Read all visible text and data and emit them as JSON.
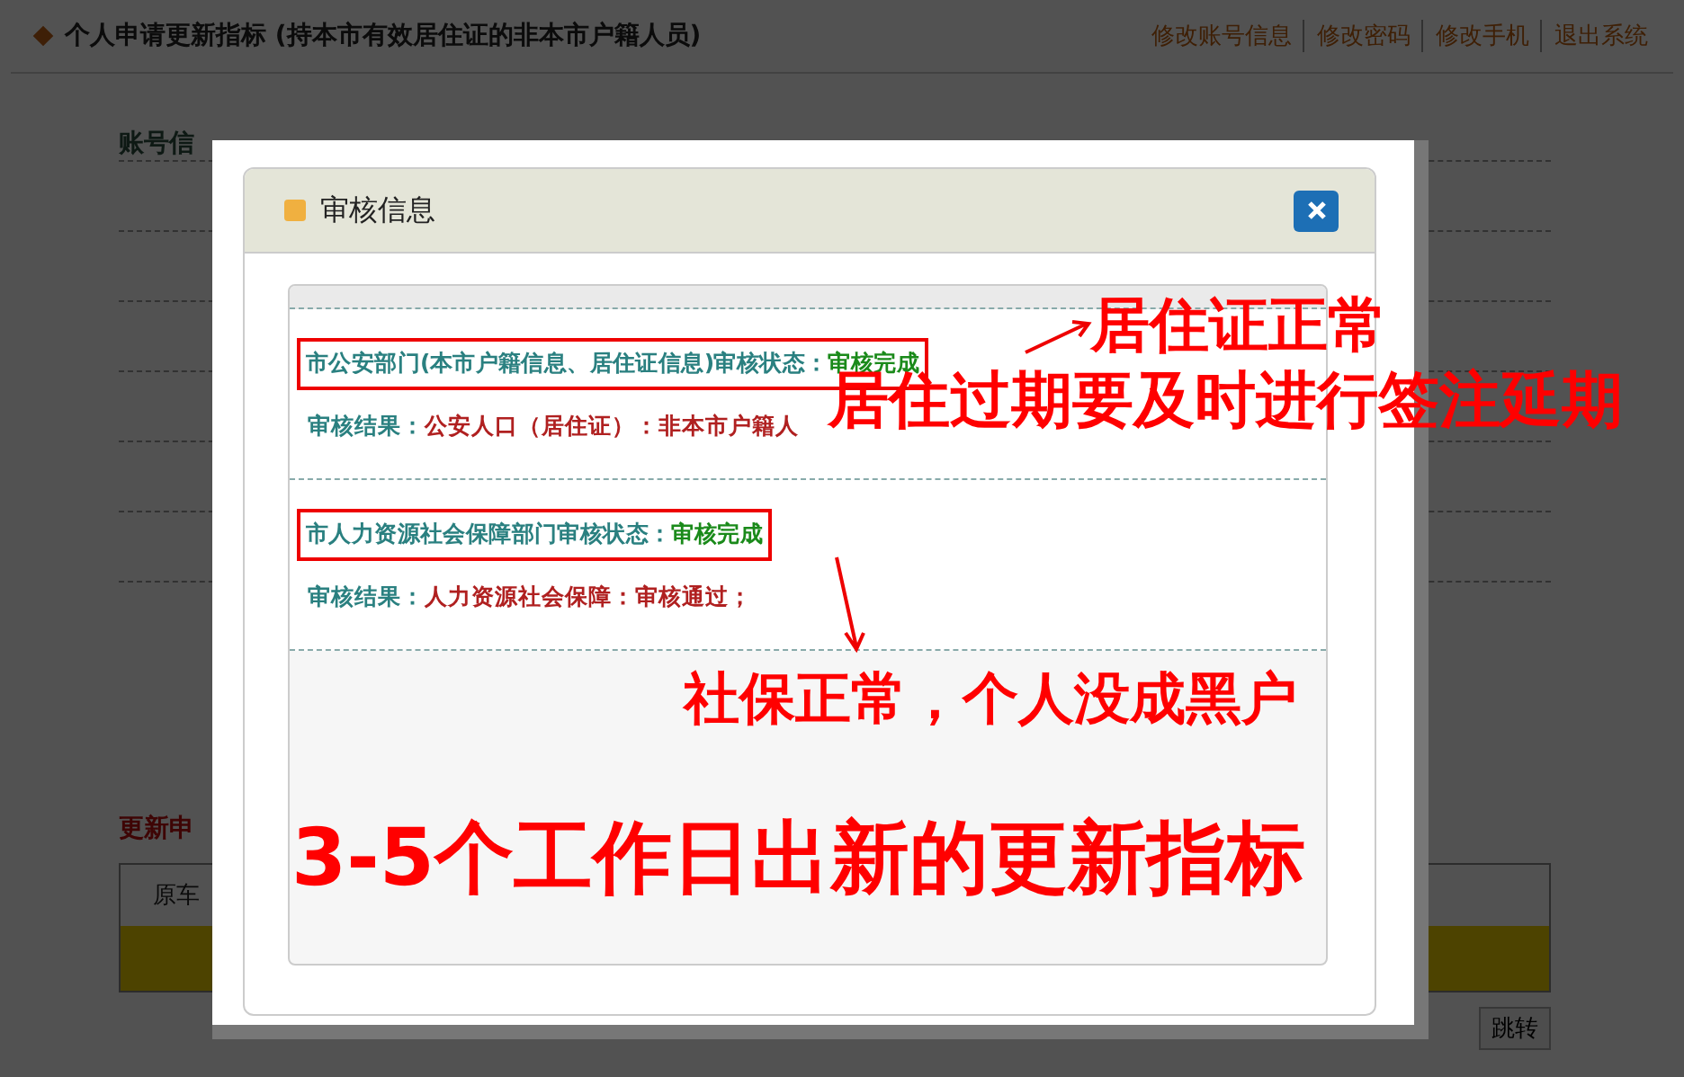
{
  "page": {
    "title": "个人申请更新指标 (持本市有效居住证的非本市户籍人员)",
    "links": [
      "修改账号信息",
      "修改密码",
      "修改手机",
      "退出系统"
    ],
    "section_1": "账号信",
    "section_2": "更新申",
    "table_header_cell": "原车",
    "jump_button": "跳转"
  },
  "dialog": {
    "title": "审核信息",
    "reviews": [
      {
        "department": "市公安部门(本市户籍信息、居住证信息)审核状态：",
        "status": "审核完成",
        "highlighted": true,
        "result_label": "审核结果：",
        "result": "公安人口（居住证）：非本市户籍人"
      },
      {
        "department": "市人力资源社会保障部门审核状态：",
        "status": "审核完成",
        "highlighted": true,
        "result_label": "审核结果：",
        "result": "人力资源社会保障：审核通过；"
      }
    ]
  },
  "annotations": [
    "居住证正常",
    "居住过期要及时进行签注延期",
    "社保正常，个人没成黑户",
    "3-5个工作日出新的更新指标"
  ]
}
